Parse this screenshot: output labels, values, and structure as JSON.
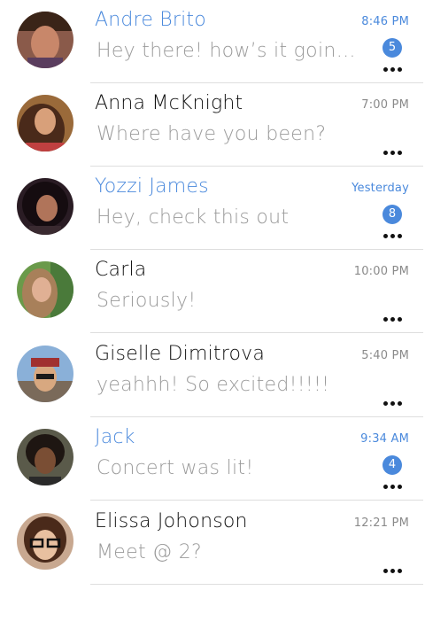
{
  "conversations": [
    {
      "name": "Andre Brito",
      "preview": "Hey there! how’s it going...",
      "time": "8:46 PM",
      "unread_count": "5",
      "unread": true,
      "more_label": "More options"
    },
    {
      "name": "Anna McKnight",
      "preview": "Where have you been?",
      "time": "7:00 PM",
      "unread_count": "",
      "unread": false,
      "more_label": "More options"
    },
    {
      "name": "Yozzi James",
      "preview": "Hey, check this out",
      "time": "Yesterday",
      "unread_count": "8",
      "unread": true,
      "more_label": "More options"
    },
    {
      "name": "Carla",
      "preview": "Seriously!",
      "time": "10:00 PM",
      "unread_count": "",
      "unread": false,
      "more_label": "More options"
    },
    {
      "name": "Giselle Dimitrova",
      "preview": "yeahhh! So excited!!!!!",
      "time": "5:40 PM",
      "unread_count": "",
      "unread": false,
      "more_label": "More options"
    },
    {
      "name": "Jack",
      "preview": "Concert was lit!",
      "time": "9:34 AM",
      "unread_count": "4",
      "unread": true,
      "more_label": "More options"
    },
    {
      "name": "Elissa Johonson",
      "preview": "Meet @ 2?",
      "time": "12:21 PM",
      "unread_count": "",
      "unread": false,
      "more_label": "More options"
    }
  ],
  "colors": {
    "accent": "#4a89dc",
    "name_read": "#111111",
    "preview": "#9a9a9a",
    "time_read": "#8a8a8a",
    "divider": "#dedede"
  },
  "icons": {
    "avatar": "user-photo",
    "more": "ellipsis-horizontal-icon",
    "badge": "unread-count-badge"
  }
}
